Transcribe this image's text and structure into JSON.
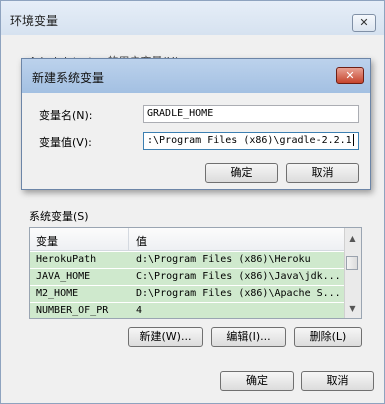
{
  "outer": {
    "title": "环境变量",
    "close_glyph": "✕",
    "user_vars_partial": "Administrator 的用户变量(U)",
    "system_vars_label": "系统变量(S)",
    "columns": [
      "变量",
      "值"
    ],
    "rows": [
      {
        "name": "HerokuPath",
        "value": "d:\\Program Files (x86)\\Heroku"
      },
      {
        "name": "JAVA_HOME",
        "value": "C:\\Program Files (x86)\\Java\\jdk..."
      },
      {
        "name": "M2_HOME",
        "value": "D:\\Program Files (x86)\\Apache S..."
      },
      {
        "name": "NUMBER_OF_PR",
        "value": "4"
      }
    ],
    "new_button": "新建(W)...",
    "edit_button": "编辑(I)...",
    "delete_button": "删除(L)",
    "ok_button": "确定",
    "cancel_button": "取消"
  },
  "inner": {
    "title": "新建系统变量",
    "close_glyph": "✕",
    "name_label": "变量名(N):",
    "value_label": "变量值(V):",
    "name_value": "GRADLE_HOME",
    "value_value": ":\\Program Files (x86)\\gradle-2.2.1",
    "ok_button": "确定",
    "cancel_button": "取消"
  }
}
